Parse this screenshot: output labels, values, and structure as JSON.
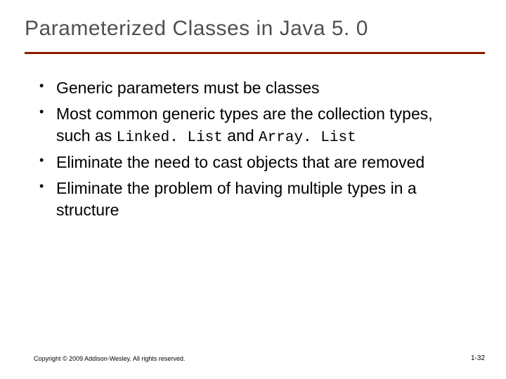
{
  "title": "Parameterized Classes in Java 5. 0",
  "bullets": [
    {
      "pre": "Generic parameters must be classes",
      "code1": "",
      "mid": "",
      "code2": "",
      "post": ""
    },
    {
      "pre": "Most common generic types are the collection types, such as ",
      "code1": "Linked. List",
      "mid": " and ",
      "code2": "Array. List",
      "post": ""
    },
    {
      "pre": "Eliminate the need to cast objects that are removed",
      "code1": "",
      "mid": "",
      "code2": "",
      "post": ""
    },
    {
      "pre": "Eliminate the problem of having multiple types in a structure",
      "code1": "",
      "mid": "",
      "code2": "",
      "post": ""
    }
  ],
  "footer_left": "Copyright © 2009 Addison-Wesley. All rights reserved.",
  "footer_right": "1-32"
}
